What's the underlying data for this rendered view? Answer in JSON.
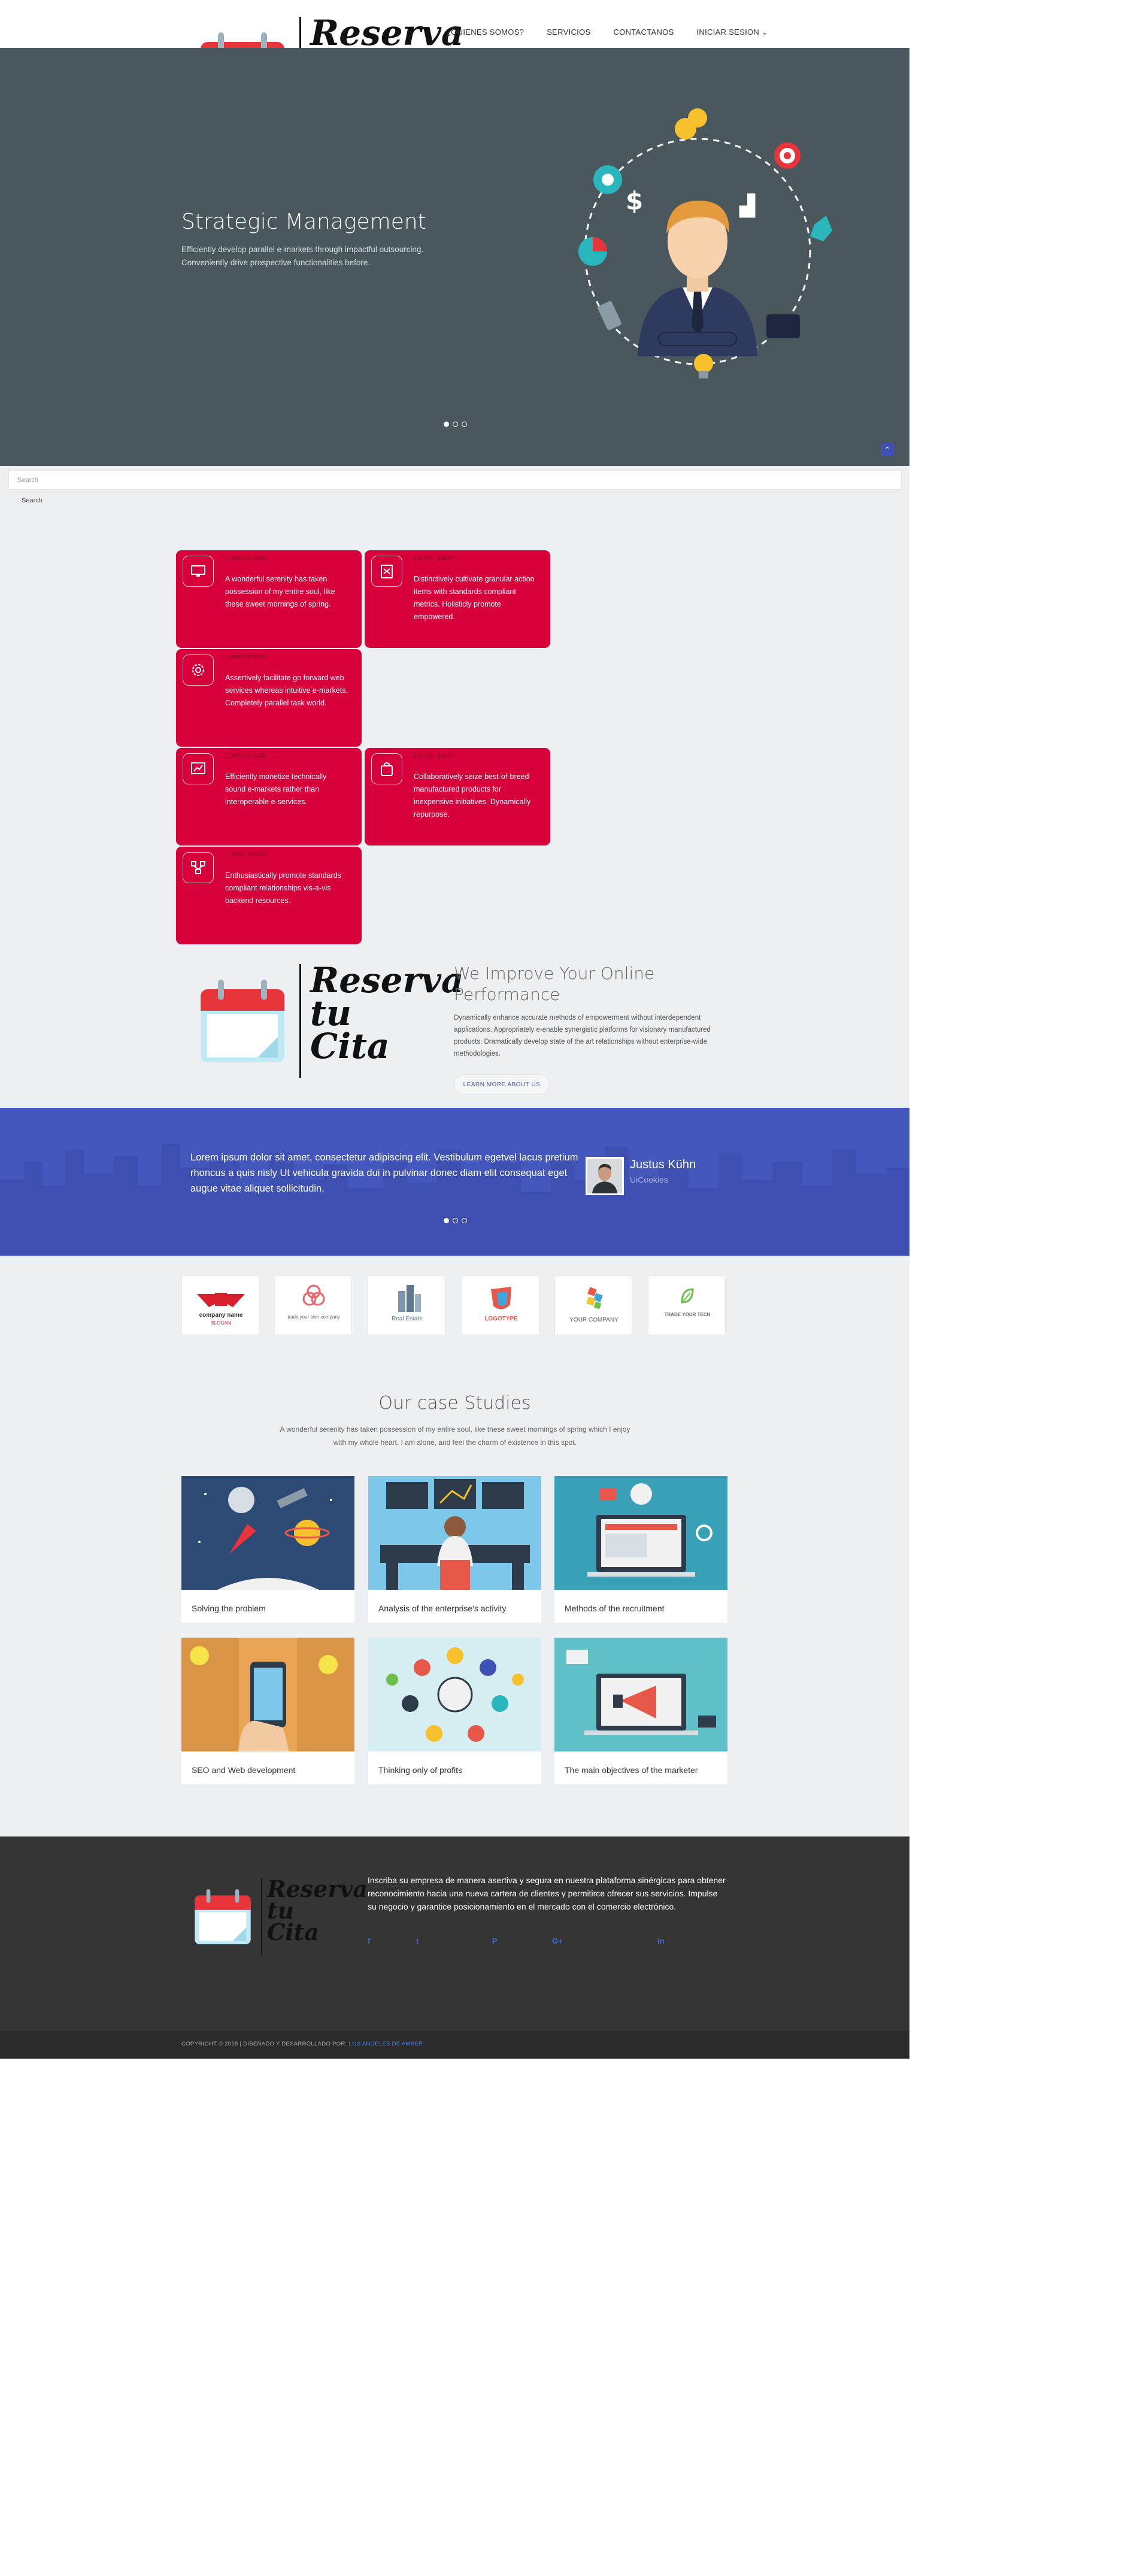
{
  "header": {
    "brand_line1": "Reserva",
    "brand_line2": "tu",
    "brand_line3": "Cita",
    "nav": [
      "¿QUIENES SOMOS?",
      "SERVICIOS",
      "CONTACTANOS",
      "INICIAR SESION"
    ]
  },
  "hero": {
    "title": "Strategic Management",
    "text": "Efficiently develop parallel e-markets through impactful outsourcing. Conveniently drive prospective functionalities before.",
    "scroll_top_icon": "chevron-up-icon"
  },
  "search": {
    "placeholder": "Search",
    "button": "Search"
  },
  "services": [
    {
      "title": "Lorem ipsum",
      "text": "A wonderful serenity has taken possession of my entire soul, like these sweet mornings of spring.",
      "icon": "monitor-icon"
    },
    {
      "title": "Lorem ipsum",
      "text": "Distinctively cultivate granular action items with standards compliant metrics. Holisticly promote empowered.",
      "icon": "clipboard-icon"
    },
    {
      "title": "Lorem ipsum",
      "text": "Assertively facilitate go forward web services whereas intuitive e-markets. Completely parallel task world.",
      "icon": "gear-icon"
    },
    {
      "title": "Lorem ipsum",
      "text": "Efficiently monetize technically sound e-markets rather than interoperable e-services.",
      "icon": "chart-icon"
    },
    {
      "title": "Lorem ipsum",
      "text": "Collaboratively seize best-of-breed manufactured products for inexpensive initiatives. Dynamically repurpose.",
      "icon": "bag-icon"
    },
    {
      "title": "Lorem ipsum",
      "text": "Enthusiastically promote standards compliant relationships vis-a-vis backend resources.",
      "icon": "network-icon"
    }
  ],
  "about": {
    "title": "We Improve Your Online Performance",
    "text": "Dynamically enhance accurate methods of empowerment without interdependent applications. Appropriately e-enable synergistic platforms for visionary manufactured products. Dramatically develop state of the art relationships without enterprise-wide methodologies.",
    "button": "LEARN MORE ABOUT US"
  },
  "testimonial": {
    "quote": "Lorem ipsum dolor sit amet, consectetur adipiscing elit. Vestibulum egetvel lacus pretium rhoncus a quis nisly Ut vehicula gravida dui in pulvinar donec diam elit consequat eget augue vitae aliquet sollicitudin.",
    "name": "Justus Kühn",
    "company": "UiCookies"
  },
  "clients": [
    {
      "label": "company name",
      "sub": "SLOGAN"
    },
    {
      "label": "trade your own company",
      "sub": ""
    },
    {
      "label": "Real Estate",
      "sub": ""
    },
    {
      "label": "LOGOTYPE",
      "sub": ""
    },
    {
      "label": "YOUR COMPANY",
      "sub": ""
    },
    {
      "label": "TRADE YOUR TECH",
      "sub": ""
    }
  ],
  "case_studies": {
    "title": "Our case Studies",
    "subtitle": "A wonderful serenity has taken possession of my entire soul, like these sweet mornings of spring which I enjoy with my whole heart. I am alone, and feel the charm of existence in this spot.",
    "items": [
      {
        "caption": "Solving the problem"
      },
      {
        "caption": "Analysis of the enterprise's activity"
      },
      {
        "caption": "Methods of the recruitment"
      },
      {
        "caption": "SEO and Web development"
      },
      {
        "caption": "Thinking only of profits"
      },
      {
        "caption": "The main objectives of the marketer"
      }
    ]
  },
  "footer": {
    "text": "Inscriba su empresa de manera asertiva y segura en nuestra plataforma sinérgicas para obtener reconocimiento hacia una nueva cartera de clientes y permitirce ofrecer sus servicios. Impulse su negocio y garantice posicionamiento en el mercado con el comercio electrónico.",
    "social": [
      "f",
      "t",
      "P",
      "G+",
      "in"
    ],
    "copyright": "COPYRIGHT © 2018 | DISEÑADO Y DESARROLLADO POR:",
    "author": "LOS ANGELES DE AMBER"
  },
  "colors": {
    "accent": "#d8003a",
    "brand_blue": "#3f51b5",
    "hero_bg": "#4a575d",
    "footer_bg": "#353535"
  }
}
